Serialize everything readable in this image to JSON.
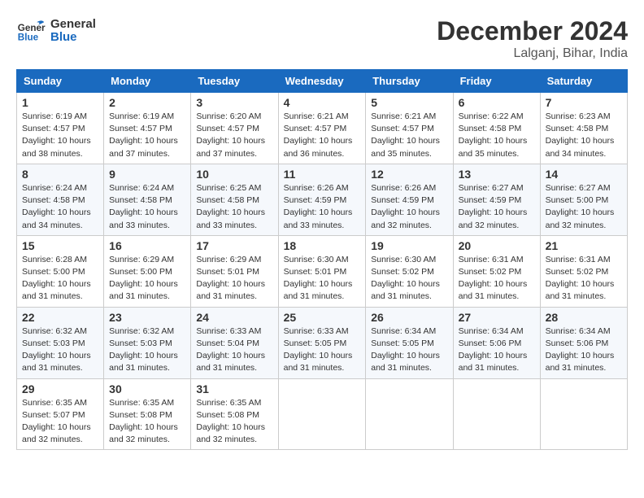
{
  "logo": {
    "text_general": "General",
    "text_blue": "Blue"
  },
  "title": "December 2024",
  "location": "Lalganj, Bihar, India",
  "days_header": [
    "Sunday",
    "Monday",
    "Tuesday",
    "Wednesday",
    "Thursday",
    "Friday",
    "Saturday"
  ],
  "weeks": [
    [
      {
        "day": "1",
        "info": "Sunrise: 6:19 AM\nSunset: 4:57 PM\nDaylight: 10 hours\nand 38 minutes."
      },
      {
        "day": "2",
        "info": "Sunrise: 6:19 AM\nSunset: 4:57 PM\nDaylight: 10 hours\nand 37 minutes."
      },
      {
        "day": "3",
        "info": "Sunrise: 6:20 AM\nSunset: 4:57 PM\nDaylight: 10 hours\nand 37 minutes."
      },
      {
        "day": "4",
        "info": "Sunrise: 6:21 AM\nSunset: 4:57 PM\nDaylight: 10 hours\nand 36 minutes."
      },
      {
        "day": "5",
        "info": "Sunrise: 6:21 AM\nSunset: 4:57 PM\nDaylight: 10 hours\nand 35 minutes."
      },
      {
        "day": "6",
        "info": "Sunrise: 6:22 AM\nSunset: 4:58 PM\nDaylight: 10 hours\nand 35 minutes."
      },
      {
        "day": "7",
        "info": "Sunrise: 6:23 AM\nSunset: 4:58 PM\nDaylight: 10 hours\nand 34 minutes."
      }
    ],
    [
      {
        "day": "8",
        "info": "Sunrise: 6:24 AM\nSunset: 4:58 PM\nDaylight: 10 hours\nand 34 minutes."
      },
      {
        "day": "9",
        "info": "Sunrise: 6:24 AM\nSunset: 4:58 PM\nDaylight: 10 hours\nand 33 minutes."
      },
      {
        "day": "10",
        "info": "Sunrise: 6:25 AM\nSunset: 4:58 PM\nDaylight: 10 hours\nand 33 minutes."
      },
      {
        "day": "11",
        "info": "Sunrise: 6:26 AM\nSunset: 4:59 PM\nDaylight: 10 hours\nand 33 minutes."
      },
      {
        "day": "12",
        "info": "Sunrise: 6:26 AM\nSunset: 4:59 PM\nDaylight: 10 hours\nand 32 minutes."
      },
      {
        "day": "13",
        "info": "Sunrise: 6:27 AM\nSunset: 4:59 PM\nDaylight: 10 hours\nand 32 minutes."
      },
      {
        "day": "14",
        "info": "Sunrise: 6:27 AM\nSunset: 5:00 PM\nDaylight: 10 hours\nand 32 minutes."
      }
    ],
    [
      {
        "day": "15",
        "info": "Sunrise: 6:28 AM\nSunset: 5:00 PM\nDaylight: 10 hours\nand 31 minutes."
      },
      {
        "day": "16",
        "info": "Sunrise: 6:29 AM\nSunset: 5:00 PM\nDaylight: 10 hours\nand 31 minutes."
      },
      {
        "day": "17",
        "info": "Sunrise: 6:29 AM\nSunset: 5:01 PM\nDaylight: 10 hours\nand 31 minutes."
      },
      {
        "day": "18",
        "info": "Sunrise: 6:30 AM\nSunset: 5:01 PM\nDaylight: 10 hours\nand 31 minutes."
      },
      {
        "day": "19",
        "info": "Sunrise: 6:30 AM\nSunset: 5:02 PM\nDaylight: 10 hours\nand 31 minutes."
      },
      {
        "day": "20",
        "info": "Sunrise: 6:31 AM\nSunset: 5:02 PM\nDaylight: 10 hours\nand 31 minutes."
      },
      {
        "day": "21",
        "info": "Sunrise: 6:31 AM\nSunset: 5:02 PM\nDaylight: 10 hours\nand 31 minutes."
      }
    ],
    [
      {
        "day": "22",
        "info": "Sunrise: 6:32 AM\nSunset: 5:03 PM\nDaylight: 10 hours\nand 31 minutes."
      },
      {
        "day": "23",
        "info": "Sunrise: 6:32 AM\nSunset: 5:03 PM\nDaylight: 10 hours\nand 31 minutes."
      },
      {
        "day": "24",
        "info": "Sunrise: 6:33 AM\nSunset: 5:04 PM\nDaylight: 10 hours\nand 31 minutes."
      },
      {
        "day": "25",
        "info": "Sunrise: 6:33 AM\nSunset: 5:05 PM\nDaylight: 10 hours\nand 31 minutes."
      },
      {
        "day": "26",
        "info": "Sunrise: 6:34 AM\nSunset: 5:05 PM\nDaylight: 10 hours\nand 31 minutes."
      },
      {
        "day": "27",
        "info": "Sunrise: 6:34 AM\nSunset: 5:06 PM\nDaylight: 10 hours\nand 31 minutes."
      },
      {
        "day": "28",
        "info": "Sunrise: 6:34 AM\nSunset: 5:06 PM\nDaylight: 10 hours\nand 31 minutes."
      }
    ],
    [
      {
        "day": "29",
        "info": "Sunrise: 6:35 AM\nSunset: 5:07 PM\nDaylight: 10 hours\nand 32 minutes."
      },
      {
        "day": "30",
        "info": "Sunrise: 6:35 AM\nSunset: 5:08 PM\nDaylight: 10 hours\nand 32 minutes."
      },
      {
        "day": "31",
        "info": "Sunrise: 6:35 AM\nSunset: 5:08 PM\nDaylight: 10 hours\nand 32 minutes."
      },
      null,
      null,
      null,
      null
    ]
  ]
}
